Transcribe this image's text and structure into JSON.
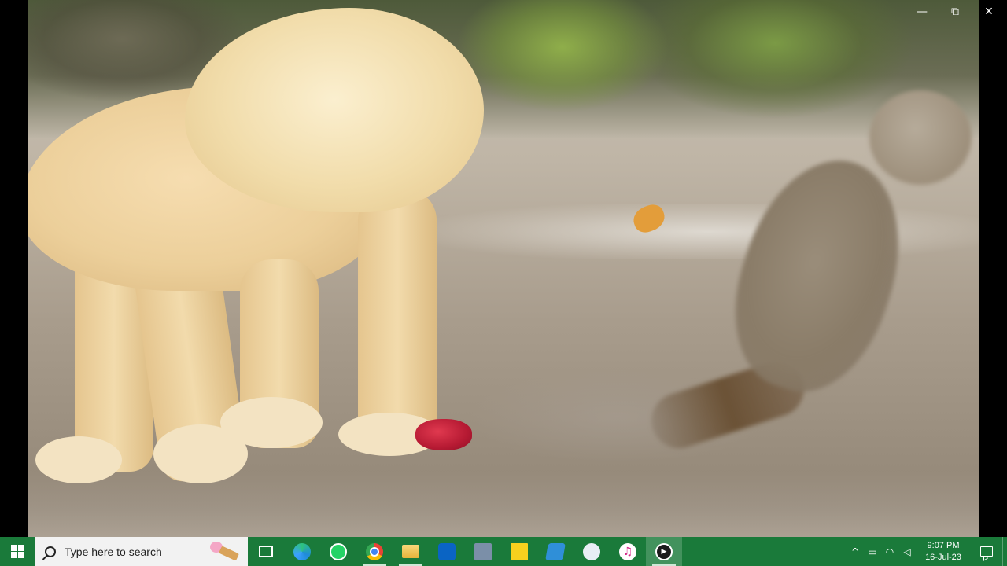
{
  "window": {
    "minimize_glyph": "—",
    "maximize_glyph": "⧉",
    "close_glyph": "✕"
  },
  "taskbar": {
    "search_placeholder": "Type here to search",
    "apps": [
      {
        "name": "task-view-icon"
      },
      {
        "name": "edge-icon"
      },
      {
        "name": "whatsapp-icon"
      },
      {
        "name": "chrome-icon"
      },
      {
        "name": "file-explorer-icon"
      },
      {
        "name": "outlook-icon"
      },
      {
        "name": "calculator-icon"
      },
      {
        "name": "sticky-notes-icon"
      },
      {
        "name": "photos-icon"
      },
      {
        "name": "paint-icon"
      },
      {
        "name": "itunes-icon"
      },
      {
        "name": "media-player-icon"
      }
    ],
    "tray": {
      "chevron_glyph": "^",
      "clock_time": "9:07 PM",
      "clock_date": "16-Jul-23"
    },
    "accent_color": "#1a7a3a"
  }
}
